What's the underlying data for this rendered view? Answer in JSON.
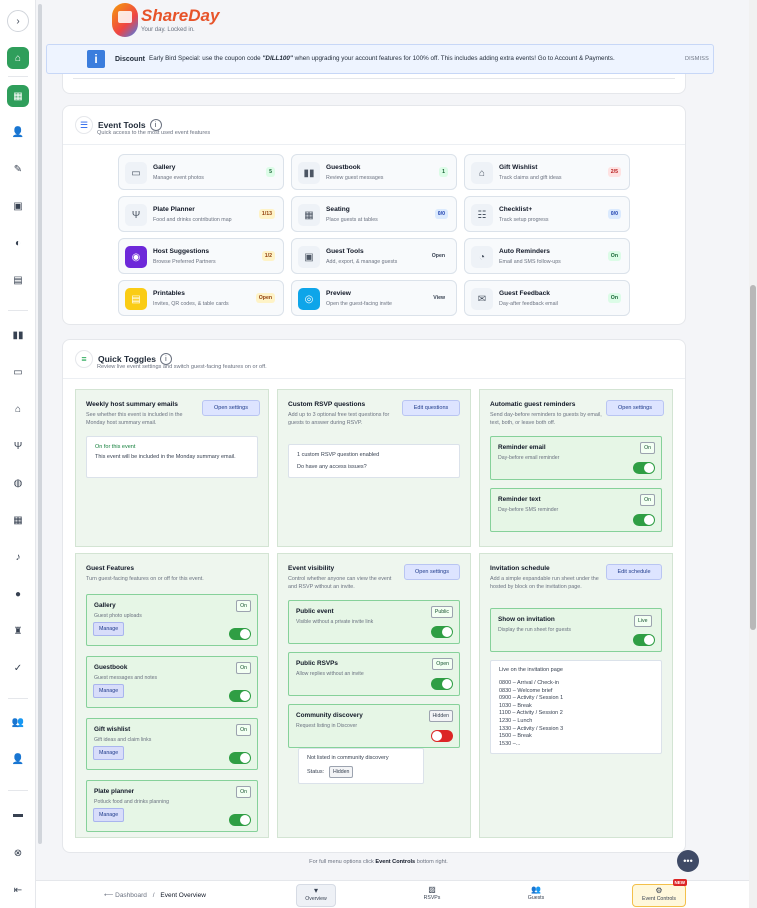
{
  "brand": {
    "name": "ShareDay",
    "tagline": "Your day. Locked in."
  },
  "banner": {
    "label": "Discount",
    "text_prefix": "Early Bird Special: use the coupon code ",
    "code": "\"DILL100\"",
    "text_suffix": " when upgrading your account features for 100% off. This includes adding extra events! Go to Account & Payments.",
    "dismiss": "DISMISS"
  },
  "event_tools": {
    "title": "Event Tools",
    "info": "i",
    "subtitle": "Quick access to the most used event features",
    "tools": [
      {
        "name": "gallery",
        "title": "Gallery",
        "sub": "Manage event photos",
        "badge": "5",
        "badge_style": "green",
        "icon": "▭",
        "icon_bg": "#eef2f7",
        "icon_solid": false
      },
      {
        "name": "guestbook",
        "title": "Guestbook",
        "sub": "Review guest messages",
        "badge": "1",
        "badge_style": "green",
        "icon": "▮▮",
        "icon_bg": "#eef2f7",
        "icon_solid": false
      },
      {
        "name": "gift-wishlist",
        "title": "Gift Wishlist",
        "sub": "Track claims and gift ideas",
        "badge": "2/5",
        "badge_style": "red",
        "icon": "⌂",
        "icon_bg": "#eef2f7",
        "icon_solid": false
      },
      {
        "name": "plate-planner",
        "title": "Plate Planner",
        "sub": "Food and drinks contribution map",
        "badge": "1/13",
        "badge_style": "yellow",
        "icon": "Ψ",
        "icon_bg": "#eef2f7",
        "icon_solid": false
      },
      {
        "name": "seating",
        "title": "Seating",
        "sub": "Place guests at tables",
        "badge": "0/0",
        "badge_style": "blue",
        "icon": "▦",
        "icon_bg": "#eef2f7",
        "icon_solid": false
      },
      {
        "name": "checklist",
        "title": "Checklist+",
        "sub": "Track setup progress",
        "badge": "0/0",
        "badge_style": "blue",
        "icon": "☷",
        "icon_bg": "#eef2f7",
        "icon_solid": false
      },
      {
        "name": "host-suggestions",
        "title": "Host Suggestions",
        "sub": "Browse Preferred Partners",
        "badge": "1/2",
        "badge_style": "yellow",
        "icon": "◉",
        "icon_bg": "#6d28d9",
        "icon_solid": true
      },
      {
        "name": "guest-tools",
        "title": "Guest Tools",
        "sub": "Add, export, & manage guests",
        "badge": "Open",
        "badge_style": "plain",
        "icon": "▣",
        "icon_bg": "#eef2f7",
        "icon_solid": false
      },
      {
        "name": "auto-reminders",
        "title": "Auto Reminders",
        "sub": "Email and SMS follow-ups",
        "badge": "On",
        "badge_style": "green",
        "icon": "◔",
        "icon_bg": "#eef2f7",
        "icon_solid": false
      },
      {
        "name": "printables",
        "title": "Printables",
        "sub": "Invites, QR codes, & table cards",
        "badge": "Open",
        "badge_style": "yellow",
        "icon": "▤",
        "icon_bg": "#facc15",
        "icon_solid": true
      },
      {
        "name": "preview",
        "title": "Preview",
        "sub": "Open the guest-facing invite",
        "badge": "View",
        "badge_style": "plain",
        "icon": "◎",
        "icon_bg": "#0ea5e9",
        "icon_solid": true
      },
      {
        "name": "guest-feedback",
        "title": "Guest Feedback",
        "sub": "Day-after feedback email",
        "badge": "On",
        "badge_style": "green",
        "icon": "✉",
        "icon_bg": "#eef2f7",
        "icon_solid": false
      }
    ]
  },
  "quick_toggles": {
    "title": "Quick Toggles",
    "info": "i",
    "subtitle": "Review live event settings and switch guest-facing features on or off.",
    "weekly": {
      "title": "Weekly host summary emails",
      "desc": "See whether this event is included in the Monday host summary email.",
      "button": "Open settings",
      "status_title": "On for this event",
      "status_text": "This event will be included in the Monday summary email."
    },
    "rsvp_questions": {
      "title": "Custom RSVP questions",
      "desc": "Add up to 3 optional free text questions for guests to answer during RSVP.",
      "button": "Edit questions",
      "line1": "1 custom RSVP question enabled",
      "line2": "Do have any access issues?"
    },
    "auto_reminders": {
      "title": "Automatic guest reminders",
      "desc": "Send day-before reminders to guests by email, text, both, or leave both off.",
      "button": "Open settings",
      "items": [
        {
          "title": "Reminder email",
          "sub": "Day-before email reminder",
          "status": "On",
          "on": true
        },
        {
          "title": "Reminder text",
          "sub": "Day-before SMS reminder",
          "status": "On",
          "on": true
        }
      ]
    },
    "guest_features": {
      "title": "Guest Features",
      "desc": "Turn guest-facing features on or off for this event.",
      "manage": "Manage",
      "items": [
        {
          "title": "Gallery",
          "sub": "Guest photo uploads",
          "status": "On",
          "on": true
        },
        {
          "title": "Guestbook",
          "sub": "Guest messages and notes",
          "status": "On",
          "on": true
        },
        {
          "title": "Gift wishlist",
          "sub": "Gift ideas and claim links",
          "status": "On",
          "on": true
        },
        {
          "title": "Plate planner",
          "sub": "Potluck food and drinks planning",
          "status": "On",
          "on": true
        }
      ]
    },
    "visibility": {
      "title": "Event visibility",
      "desc": "Control whether anyone can view the event and RSVP without an invite.",
      "button": "Open settings",
      "items": [
        {
          "title": "Public event",
          "sub": "Visible without a private invite link",
          "status": "Public",
          "on": true
        },
        {
          "title": "Public RSVPs",
          "sub": "Allow replies without an invite",
          "status": "Open",
          "on": true
        },
        {
          "title": "Community discovery",
          "sub": "Request listing in Discover",
          "status": "Hidden",
          "on": false
        }
      ],
      "not_listed": "Not listed in community discovery",
      "status_label": "Status:",
      "status_value": "Hidden"
    },
    "schedule": {
      "title": "Invitation schedule",
      "desc": "Add a simple expandable run sheet under the hosted by block on the invitation page.",
      "button": "Edit schedule",
      "item": {
        "title": "Show on invitation",
        "sub": "Display the run sheet for guests",
        "status": "Live",
        "on": true
      },
      "live_title": "Live on the invitation page",
      "lines": [
        "0800 – Arrival / Check-in",
        "0830 – Welcome brief",
        "0900 – Activity / Session 1",
        "1030 – Break",
        "1100 – Activity / Session 2",
        "1230 – Lunch",
        "1330 – Activity / Session 3",
        "1500 – Break",
        "1530 –..."
      ]
    }
  },
  "footer": {
    "prefix": "For full menu options click ",
    "bold": "Event Controls",
    "suffix": " bottom right."
  },
  "breadcrumb": {
    "back": "⟵ Dashboard",
    "sep": "/",
    "current": "Event Overview"
  },
  "bottom_nav": [
    {
      "name": "overview",
      "label": "Overview",
      "icon": "▾",
      "active": true
    },
    {
      "name": "rsvps",
      "label": "RSVPs",
      "icon": "▨",
      "active": false
    },
    {
      "name": "guests",
      "label": "Guests",
      "icon": "👥",
      "active": false
    },
    {
      "name": "event-controls",
      "label": "Event Controls",
      "icon": "⚙",
      "active": false,
      "badge": "NEW"
    }
  ],
  "sidebar": {
    "toggle": "›",
    "icons": [
      "home",
      "grid",
      "user-plus",
      "edit",
      "id-card",
      "palette",
      "printer",
      "book",
      "image",
      "gift",
      "utensils",
      "globe",
      "calendar",
      "bell",
      "chat",
      "seat",
      "check",
      "users",
      "user",
      "card",
      "help",
      "logout"
    ]
  }
}
